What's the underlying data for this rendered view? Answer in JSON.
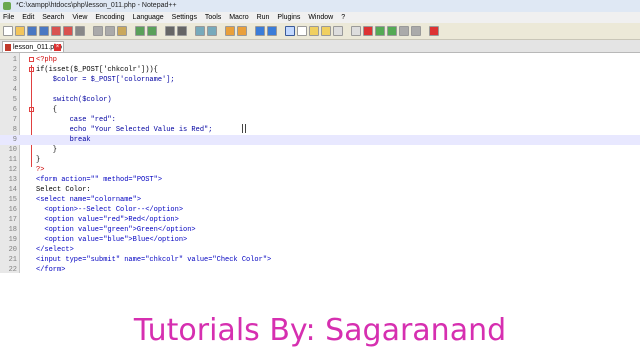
{
  "window": {
    "title": "*C:\\xampp\\htdocs\\php\\lesson_011.php - Notepad++"
  },
  "menu": [
    "File",
    "Edit",
    "Search",
    "View",
    "Encoding",
    "Language",
    "Settings",
    "Tools",
    "Macro",
    "Run",
    "Plugins",
    "Window",
    "?"
  ],
  "tab": {
    "label": "lesson_011.php"
  },
  "editor": {
    "lines": [
      {
        "n": "1",
        "text": "<?php"
      },
      {
        "n": "2",
        "text": "if(isset($_POST['chkcolr'])){"
      },
      {
        "n": "3",
        "text": "    $color = $_POST['colorname'];"
      },
      {
        "n": "4",
        "text": ""
      },
      {
        "n": "5",
        "text": "    switch($color)"
      },
      {
        "n": "6",
        "text": "    {"
      },
      {
        "n": "7",
        "text": "        case \"red\":"
      },
      {
        "n": "8",
        "text": "        echo \"Your Selected Value is Red\";"
      },
      {
        "n": "9",
        "text": "        break"
      },
      {
        "n": "10",
        "text": "    }"
      },
      {
        "n": "11",
        "text": "}"
      },
      {
        "n": "12",
        "text": "?>"
      },
      {
        "n": "13",
        "text": "<form action=\"\" method=\"POST\">"
      },
      {
        "n": "14",
        "text": "Select Color:"
      },
      {
        "n": "15",
        "text": "<select name=\"colorname\">"
      },
      {
        "n": "16",
        "text": "  <option>--Select Color--</option>"
      },
      {
        "n": "17",
        "text": "  <option value=\"red\">Red</option>"
      },
      {
        "n": "18",
        "text": "  <option value=\"green\">Green</option>"
      },
      {
        "n": "19",
        "text": "  <option value=\"blue\">Blue</option>"
      },
      {
        "n": "20",
        "text": "</select>"
      },
      {
        "n": "21",
        "text": "<input type=\"submit\" name=\"chkcolr\" value=\"Check Color\">"
      },
      {
        "n": "22",
        "text": "</form>"
      }
    ]
  },
  "watermark": "Tutorials By: Sagaranand"
}
